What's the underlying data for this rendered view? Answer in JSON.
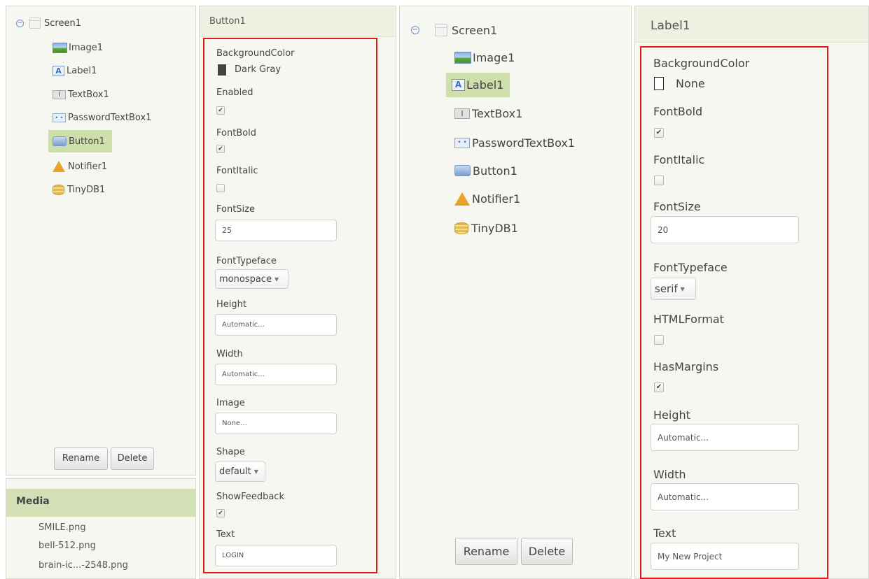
{
  "left": {
    "components": {
      "screen": "Screen1",
      "items": [
        {
          "label": "Image1",
          "icon": "image-icon"
        },
        {
          "label": "Label1",
          "icon": "label-icon"
        },
        {
          "label": "TextBox1",
          "icon": "textbox-icon"
        },
        {
          "label": "PasswordTextBox1",
          "icon": "password-icon"
        },
        {
          "label": "Button1",
          "icon": "button-icon",
          "selected": true
        },
        {
          "label": "Notifier1",
          "icon": "notifier-icon"
        },
        {
          "label": "TinyDB1",
          "icon": "tinydb-icon"
        }
      ],
      "rename_label": "Rename",
      "delete_label": "Delete"
    },
    "media": {
      "title": "Media",
      "files": [
        "SMILE.png",
        "bell-512.png",
        "brain-ic...-2548.png"
      ]
    },
    "properties": {
      "title": "Button1",
      "background_color": {
        "label": "BackgroundColor",
        "value": "Dark Gray"
      },
      "enabled": {
        "label": "Enabled",
        "checked": true
      },
      "font_bold": {
        "label": "FontBold",
        "checked": true
      },
      "font_italic": {
        "label": "FontItalic",
        "checked": false
      },
      "font_size": {
        "label": "FontSize",
        "value": "25"
      },
      "font_typeface": {
        "label": "FontTypeface",
        "value": "monospace"
      },
      "height": {
        "label": "Height",
        "value": "Automatic..."
      },
      "width": {
        "label": "Width",
        "value": "Automatic..."
      },
      "image": {
        "label": "Image",
        "value": "None..."
      },
      "shape": {
        "label": "Shape",
        "value": "default"
      },
      "show_feedback": {
        "label": "ShowFeedback",
        "checked": true
      },
      "text": {
        "label": "Text",
        "value": "LOGIN"
      }
    }
  },
  "right": {
    "components": {
      "screen": "Screen1",
      "items": [
        {
          "label": "Image1",
          "icon": "image-icon"
        },
        {
          "label": "Label1",
          "icon": "label-icon",
          "selected": true
        },
        {
          "label": "TextBox1",
          "icon": "textbox-icon"
        },
        {
          "label": "PasswordTextBox1",
          "icon": "password-icon"
        },
        {
          "label": "Button1",
          "icon": "button-icon"
        },
        {
          "label": "Notifier1",
          "icon": "notifier-icon"
        },
        {
          "label": "TinyDB1",
          "icon": "tinydb-icon"
        }
      ],
      "rename_label": "Rename",
      "delete_label": "Delete"
    },
    "properties": {
      "title": "Label1",
      "background_color": {
        "label": "BackgroundColor",
        "value": "None"
      },
      "font_bold": {
        "label": "FontBold",
        "checked": true
      },
      "font_italic": {
        "label": "FontItalic",
        "checked": false
      },
      "font_size": {
        "label": "FontSize",
        "value": "20"
      },
      "font_typeface": {
        "label": "FontTypeface",
        "value": "serif"
      },
      "html_format": {
        "label": "HTMLFormat",
        "checked": false
      },
      "has_margins": {
        "label": "HasMargins",
        "checked": true
      },
      "height": {
        "label": "Height",
        "value": "Automatic..."
      },
      "width": {
        "label": "Width",
        "value": "Automatic..."
      },
      "text": {
        "label": "Text",
        "value": "My New Project"
      }
    }
  },
  "glyphs": {
    "check": "✔",
    "caret": "▼",
    "collapse": "−",
    "label_icon": "A",
    "textbox_icon": "I",
    "password_icon": "• •"
  },
  "colors": {
    "highlight_box": "#e41b1b",
    "selected_item": "#cfdfab",
    "panel_header": "#eef2e3",
    "media_header": "#d3e0b5",
    "dark_gray_swatch": "#444444"
  }
}
